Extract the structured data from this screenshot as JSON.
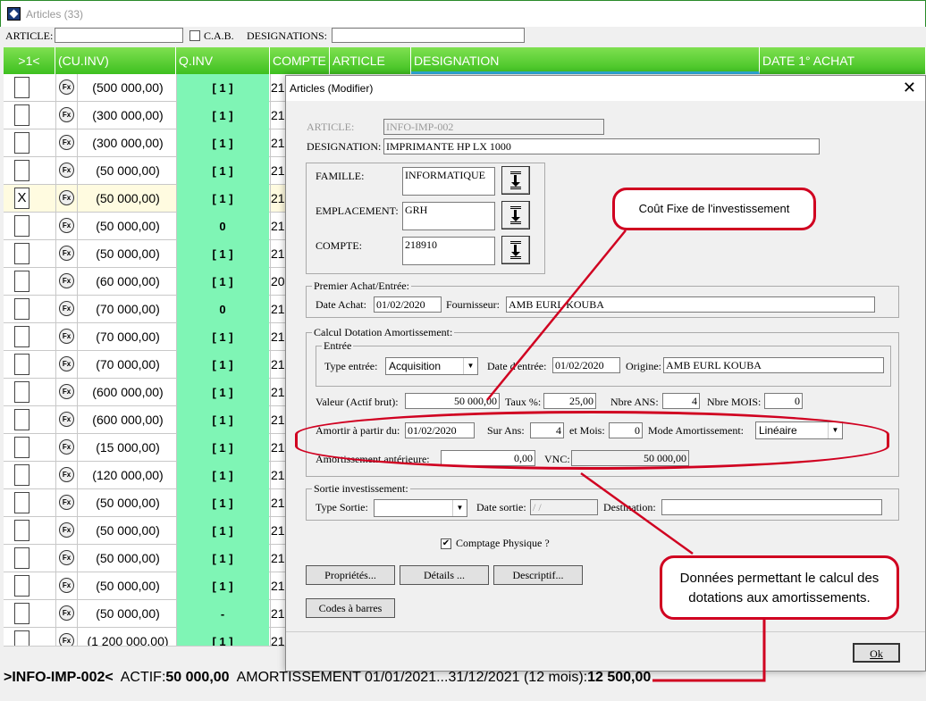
{
  "window": {
    "title": "Articles (33)"
  },
  "filters": {
    "article_label": "ARTICLE:",
    "cab_label": "C.A.B.",
    "designations_label": "DESIGNATIONS:"
  },
  "grid": {
    "headers": [
      ">1<",
      "(CU.INV)",
      "Q.INV",
      "COMPTE",
      "ARTICLE",
      "DESIGNATION",
      "DATE 1° ACHAT"
    ],
    "rows": [
      {
        "check": "",
        "value": "(500 000,00)",
        "qinv": "[ 1 ]",
        "compte": "21:"
      },
      {
        "check": "",
        "value": "(300 000,00)",
        "qinv": "[ 1 ]",
        "compte": "21:"
      },
      {
        "check": "",
        "value": "(300 000,00)",
        "qinv": "[ 1 ]",
        "compte": "21:"
      },
      {
        "check": "",
        "value": "(50 000,00)",
        "qinv": "[ 1 ]",
        "compte": "21:"
      },
      {
        "check": "X",
        "value": "(50 000,00)",
        "qinv": "[ 1 ]",
        "compte": "21:"
      },
      {
        "check": "",
        "value": "(50 000,00)",
        "qinv": "0",
        "compte": "21:"
      },
      {
        "check": "",
        "value": "(50 000,00)",
        "qinv": "[ 1 ]",
        "compte": "21:"
      },
      {
        "check": "",
        "value": "(60 000,00)",
        "qinv": "[ 1 ]",
        "compte": "20"
      },
      {
        "check": "",
        "value": "(70 000,00)",
        "qinv": "0",
        "compte": "21:"
      },
      {
        "check": "",
        "value": "(70 000,00)",
        "qinv": "[ 1 ]",
        "compte": "21:"
      },
      {
        "check": "",
        "value": "(70 000,00)",
        "qinv": "[ 1 ]",
        "compte": "21:"
      },
      {
        "check": "",
        "value": "(600 000,00)",
        "qinv": "[ 1 ]",
        "compte": "21:"
      },
      {
        "check": "",
        "value": "(600 000,00)",
        "qinv": "[ 1 ]",
        "compte": "21:"
      },
      {
        "check": "",
        "value": "(15 000,00)",
        "qinv": "[ 1 ]",
        "compte": "21:"
      },
      {
        "check": "",
        "value": "(120 000,00)",
        "qinv": "[ 1 ]",
        "compte": "21:"
      },
      {
        "check": "",
        "value": "(50 000,00)",
        "qinv": "[ 1 ]",
        "compte": "21:"
      },
      {
        "check": "",
        "value": "(50 000,00)",
        "qinv": "[ 1 ]",
        "compte": "21:"
      },
      {
        "check": "",
        "value": "(50 000,00)",
        "qinv": "[ 1 ]",
        "compte": "21:"
      },
      {
        "check": "",
        "value": "(50 000,00)",
        "qinv": "[ 1 ]",
        "compte": "21:"
      },
      {
        "check": "",
        "value": "(50 000,00)",
        "qinv": "-",
        "compte": "21:"
      },
      {
        "check": "",
        "value": "(1 200 000,00)",
        "qinv": "[ 1 ]",
        "compte": "21:"
      }
    ]
  },
  "status": {
    "code": ">INFO-IMP-002<",
    "actif_label": "ACTIF:",
    "actif_value": "50 000,00",
    "amort_label": "AMORTISSEMENT 01/01/2021...31/12/2021  (12 mois):",
    "amort_value": "12 500,00"
  },
  "dialog": {
    "title": "Articles  (Modifier)",
    "close": "✕",
    "article_label": "ARTICLE:",
    "article_value": "INFO-IMP-002",
    "designation_label": "DESIGNATION:",
    "designation_value": "IMPRIMANTE HP LX 1000",
    "famille_label": "FAMILLE:",
    "famille_value": "INFORMATIQUE",
    "emplacement_label": "EMPLACEMENT:",
    "emplacement_value": "GRH",
    "compte_label": "COMPTE:",
    "compte_value": "218910",
    "achat_group": "Premier Achat/Entrée:",
    "date_achat_label": "Date Achat:",
    "date_achat_value": "01/02/2020",
    "fournisseur_label": "Fournisseur:",
    "fournisseur_value": "AMB EURL KOUBA",
    "calcul_group": "Calcul Dotation Amortissement:",
    "entree_group": "Entrée",
    "type_entree_label": "Type entrée:",
    "type_entree_value": "Acquisition",
    "date_entree_label": "Date d'entrée:",
    "date_entree_value": "01/02/2020",
    "origine_label": "Origine:",
    "origine_value": "AMB EURL KOUBA",
    "valeur_label": "Valeur (Actif brut):",
    "valeur_value": "50 000,00",
    "taux_label": "Taux %:",
    "taux_value": "25,00",
    "nbre_ans_label": "Nbre ANS:",
    "nbre_ans_value": "4",
    "nbre_mois_label": "Nbre MOIS:",
    "nbre_mois_value": "0",
    "amortir_label": "Amortir à partir du:",
    "amortir_value": "01/02/2020",
    "sur_ans_label": "Sur Ans:",
    "sur_ans_value": "4",
    "et_mois_label": "et Mois:",
    "et_mois_value": "0",
    "mode_label": "Mode Amortissement:",
    "mode_value": "Linéaire",
    "amort_ant_label": "Amortissement antérieure:",
    "amort_ant_value": "0,00",
    "vnc_label": "VNC:",
    "vnc_value": "50 000,00",
    "sortie_group": "Sortie investissement:",
    "type_sortie_label": "Type Sortie:",
    "type_sortie_value": "",
    "date_sortie_label": "Date sortie:",
    "date_sortie_value": " / /",
    "destination_label": "Destination:",
    "destination_value": "",
    "comptage_label": "Comptage Physique ?",
    "btn_proprietes": "Propriétés...",
    "btn_details": "Détails ...",
    "btn_descriptif": "Descriptif...",
    "btn_codes": "Codes à barres",
    "btn_ok": "Ok"
  },
  "callouts": {
    "cout_fixe": "Coût Fixe de l'investissement",
    "donnees": "Données permettant le calcul des dotations aux amortissements."
  },
  "colors": {
    "header_green": "#3ec020",
    "qinv_green": "#7ff5b5",
    "callout_red": "#d00020"
  }
}
